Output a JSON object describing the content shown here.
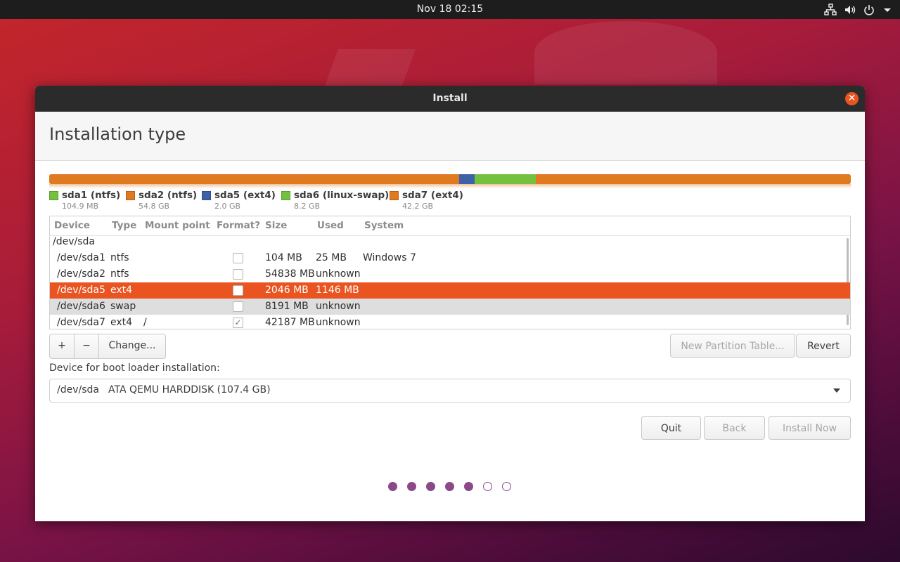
{
  "topbar": {
    "clock": "Nov 18  02:15",
    "icons": [
      "network-icon",
      "volume-icon",
      "power-icon",
      "menu-arrow-icon"
    ]
  },
  "window": {
    "title": "Install",
    "close_glyph": "✕",
    "page_title": "Installation type"
  },
  "partition_bar": {
    "segments": [
      {
        "name": "sda1",
        "size_gb": 0.1,
        "color": "#e07a20"
      },
      {
        "name": "sda2",
        "size_gb": 54.8,
        "color": "#e07a20"
      },
      {
        "name": "sda5",
        "size_gb": 2.0,
        "color": "#3d62a8"
      },
      {
        "name": "sda6",
        "size_gb": 8.2,
        "color": "#73c13e"
      },
      {
        "name": "sda7",
        "size_gb": 42.2,
        "color": "#e07a20"
      }
    ]
  },
  "legend": [
    {
      "name": "sda1 (ntfs)",
      "size": "104.9 MB",
      "color": "#73c13e"
    },
    {
      "name": "sda2 (ntfs)",
      "size": "54.8 GB",
      "color": "#e07a20"
    },
    {
      "name": "sda5 (ext4)",
      "size": "2.0 GB",
      "color": "#3d62a8"
    },
    {
      "name": "sda6 (linux-swap)",
      "size": "8.2 GB",
      "color": "#73c13e"
    },
    {
      "name": "sda7 (ext4)",
      "size": "42.2 GB",
      "color": "#e07a20"
    }
  ],
  "table": {
    "headers": {
      "device": "Device",
      "type": "Type",
      "mount": "Mount point",
      "format": "Format?",
      "size": "Size",
      "used": "Used",
      "system": "System"
    },
    "disk_row": "/dev/sda",
    "rows": [
      {
        "device": "/dev/sda1",
        "type": "ntfs",
        "mount": "",
        "format": false,
        "size": "104 MB",
        "used": "25 MB",
        "system": "Windows 7"
      },
      {
        "device": "/dev/sda2",
        "type": "ntfs",
        "mount": "",
        "format": false,
        "size": "54838 MB",
        "used": "unknown",
        "system": ""
      },
      {
        "device": "/dev/sda5",
        "type": "ext4",
        "mount": "",
        "format": false,
        "size": "2046 MB",
        "used": "1146 MB",
        "system": ""
      },
      {
        "device": "/dev/sda6",
        "type": "swap",
        "mount": "",
        "format": false,
        "size": "8191 MB",
        "used": "unknown",
        "system": ""
      },
      {
        "device": "/dev/sda7",
        "type": "ext4",
        "mount": "/",
        "format": true,
        "size": "42187 MB",
        "used": "unknown",
        "system": ""
      }
    ],
    "selected_row": 2,
    "hover_row": 3,
    "check_glyph": "✓"
  },
  "toolbar": {
    "add_label": "+",
    "remove_label": "−",
    "change_label": "Change...",
    "new_table_label": "New Partition Table...",
    "revert_label": "Revert"
  },
  "bootloader": {
    "label": "Device for boot loader installation:",
    "device": "/dev/sda",
    "description": "ATA QEMU HARDDISK (107.4 GB)"
  },
  "nav": {
    "quit_label": "Quit",
    "back_label": "Back",
    "install_label": "Install Now"
  },
  "progress": {
    "total_steps": 7,
    "completed_steps": 5,
    "accent": "#8a4a89"
  },
  "colors": {
    "accent": "#e95420"
  }
}
